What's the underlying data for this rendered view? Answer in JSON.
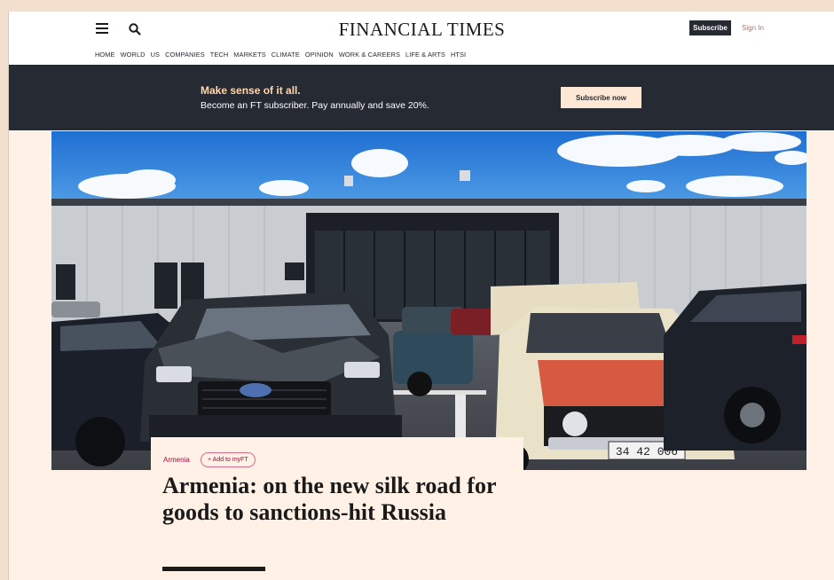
{
  "header": {
    "masthead": "FINANCIAL TIMES",
    "subscribe_label": "Subscribe",
    "signin_label": "Sign In",
    "nav": [
      "HOME",
      "WORLD",
      "US",
      "COMPANIES",
      "TECH",
      "MARKETS",
      "CLIMATE",
      "OPINION",
      "WORK & CAREERS",
      "LIFE & ARTS",
      "HTSI"
    ]
  },
  "promo": {
    "title": "Make sense of it all.",
    "subtitle": "Become an FT subscriber. Pay annually and save 20%.",
    "button_label": "Subscribe now"
  },
  "article": {
    "topic": "Armenia",
    "myft_label": "+ Add to myFT",
    "headline": "Armenia: on the new silk road for goods to sanctions-hit Russia",
    "plate_text": "34 42 006"
  },
  "icons": {
    "menu": "menu-icon",
    "search": "search-icon"
  },
  "colors": {
    "brand_background": "#fff1e5",
    "dark": "#262a33",
    "accent": "#990f3d",
    "promo_highlight": "#ffd8b0"
  }
}
